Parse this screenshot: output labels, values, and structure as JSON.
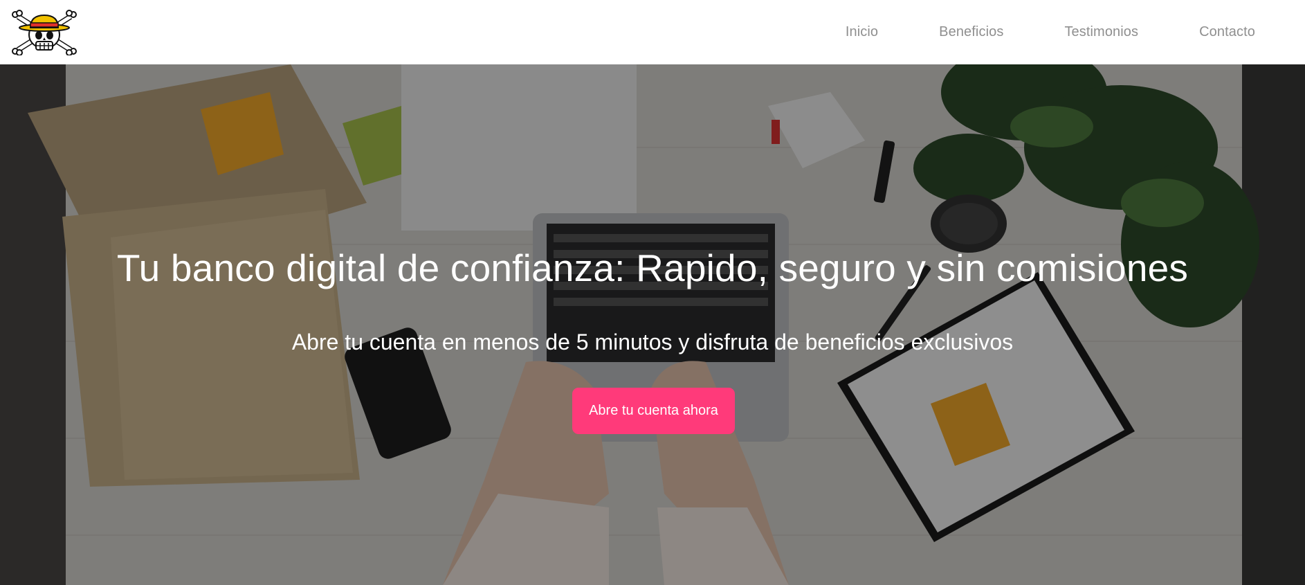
{
  "header": {
    "logo_alt": "straw-hat-jolly-roger-logo",
    "nav": [
      {
        "label": "Inicio"
      },
      {
        "label": "Beneficios"
      },
      {
        "label": "Testimonios"
      },
      {
        "label": "Contacto"
      }
    ]
  },
  "hero": {
    "title": "Tu banco digital de confianza: Rapido, seguro y sin comisiones",
    "subtitle": "Abre tu cuenta en menos de 5 minutos y disfruta de beneficios exclusivos",
    "cta_label": "Abre tu cuenta ahora",
    "background_image": "office-desk-laptop-photo"
  },
  "colors": {
    "nav_text": "#8f8f8f",
    "cta": "#ff3a7a",
    "hero_text": "#ffffff",
    "hat_yellow": "#f2c200",
    "hat_band": "#e0302a"
  }
}
